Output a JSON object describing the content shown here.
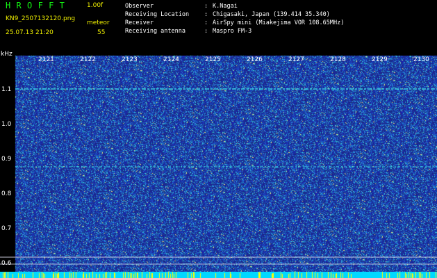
{
  "header": {
    "app_title": "HROFFT",
    "version": "1.00f",
    "filename": "KN9_2507132120.png",
    "meteor_label": "meteor",
    "meteor_count": "55",
    "datetime": "25.07.13 21:20",
    "info": [
      {
        "label": "Observer",
        "value": "K.Nagai"
      },
      {
        "label": "Receiving Location",
        "value": "Chigasaki, Japan (139.414 35.340)"
      },
      {
        "label": "Receiver",
        "value": "AirSpy mini (Miakejima VOR 108.65MHz)"
      },
      {
        "label": "Receiving antenna",
        "value": "Maspro FM-3"
      }
    ]
  },
  "plot": {
    "unit_label": "kHz",
    "y_ticks": [
      "1.1",
      "1.0",
      "0.9",
      "0.8",
      "0.7",
      "0.6"
    ],
    "time_ticks": [
      "2121",
      "2122",
      "2123",
      "2124",
      "2125",
      "2126",
      "2127",
      "2128",
      "2129",
      "2130"
    ]
  },
  "colors": {
    "background": "#000000",
    "waterfall_base": "#1c2e96",
    "title_green": "#13f713",
    "header_yellow": "#f0f000",
    "text_white": "#ffffff",
    "carrier_cyan": "#3fe0e8",
    "strip_cyan": "#00d8ff",
    "strip_yellow": "#ffff00"
  }
}
